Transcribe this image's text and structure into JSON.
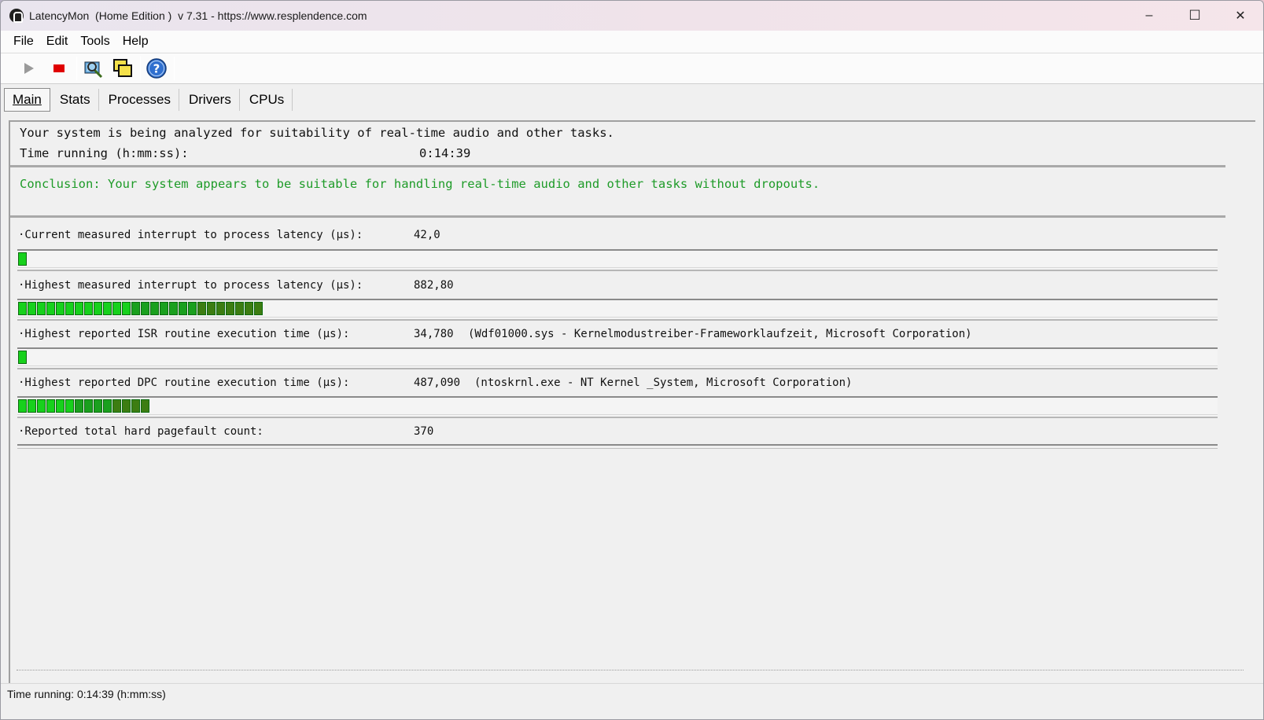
{
  "window": {
    "title": "LatencyMon  (Home Edition )  v 7.31 - https://www.resplendence.com",
    "controls": {
      "minimize": "–",
      "maximize": "☐",
      "close": "✕"
    }
  },
  "menu": [
    {
      "label": "File"
    },
    {
      "label": "Edit"
    },
    {
      "label": "Tools"
    },
    {
      "label": "Help"
    }
  ],
  "toolbar": {
    "icons": [
      "play-icon",
      "stop-icon",
      "scan-drivers-icon",
      "windows-icon",
      "help-icon"
    ],
    "colors": {
      "play": "#9a9a9a",
      "stop": "#e00000",
      "help": "#2f6fcf"
    }
  },
  "tabs": [
    {
      "label": "Main",
      "active": true
    },
    {
      "label": "Stats",
      "active": false
    },
    {
      "label": "Processes",
      "active": false
    },
    {
      "label": "Drivers",
      "active": false
    },
    {
      "label": "CPUs",
      "active": false
    }
  ],
  "main": {
    "status_line": "Your system is being analyzed for suitability of real-time audio and other tasks.",
    "time_label": "Time running (h:mm:ss):",
    "time_value": "0:14:39",
    "conclusion": "Conclusion: Your system appears to be suitable for handling real-time audio and other tasks without dropouts.",
    "metrics": [
      {
        "label": "·Current measured interrupt to process latency (µs):",
        "value": "42,0",
        "detail": "",
        "bar_segments": 1
      },
      {
        "label": "·Highest measured interrupt to process latency (µs):",
        "value": "882,80",
        "detail": "",
        "bar_segments": 26
      },
      {
        "label": "·Highest reported ISR routine execution time (µs):",
        "value": "34,780",
        "detail": "(Wdf01000.sys - Kernelmodustreiber-Frameworklaufzeit, Microsoft Corporation)",
        "bar_segments": 1
      },
      {
        "label": "·Highest reported DPC routine execution time (µs):",
        "value": "487,090",
        "detail": "(ntoskrnl.exe - NT Kernel _System, Microsoft Corporation)",
        "bar_segments": 14
      },
      {
        "label": "·Reported total hard pagefault count:",
        "value": "370",
        "detail": "",
        "bar_segments": null
      }
    ]
  },
  "statusbar": {
    "text": "Time running: 0:14:39  (h:mm:ss)"
  },
  "colors": {
    "conclusion": "#1e9b28",
    "bar_bright": "#17d11c",
    "bar_mid": "#1aa01e",
    "bar_dark": "#3d7d12"
  }
}
